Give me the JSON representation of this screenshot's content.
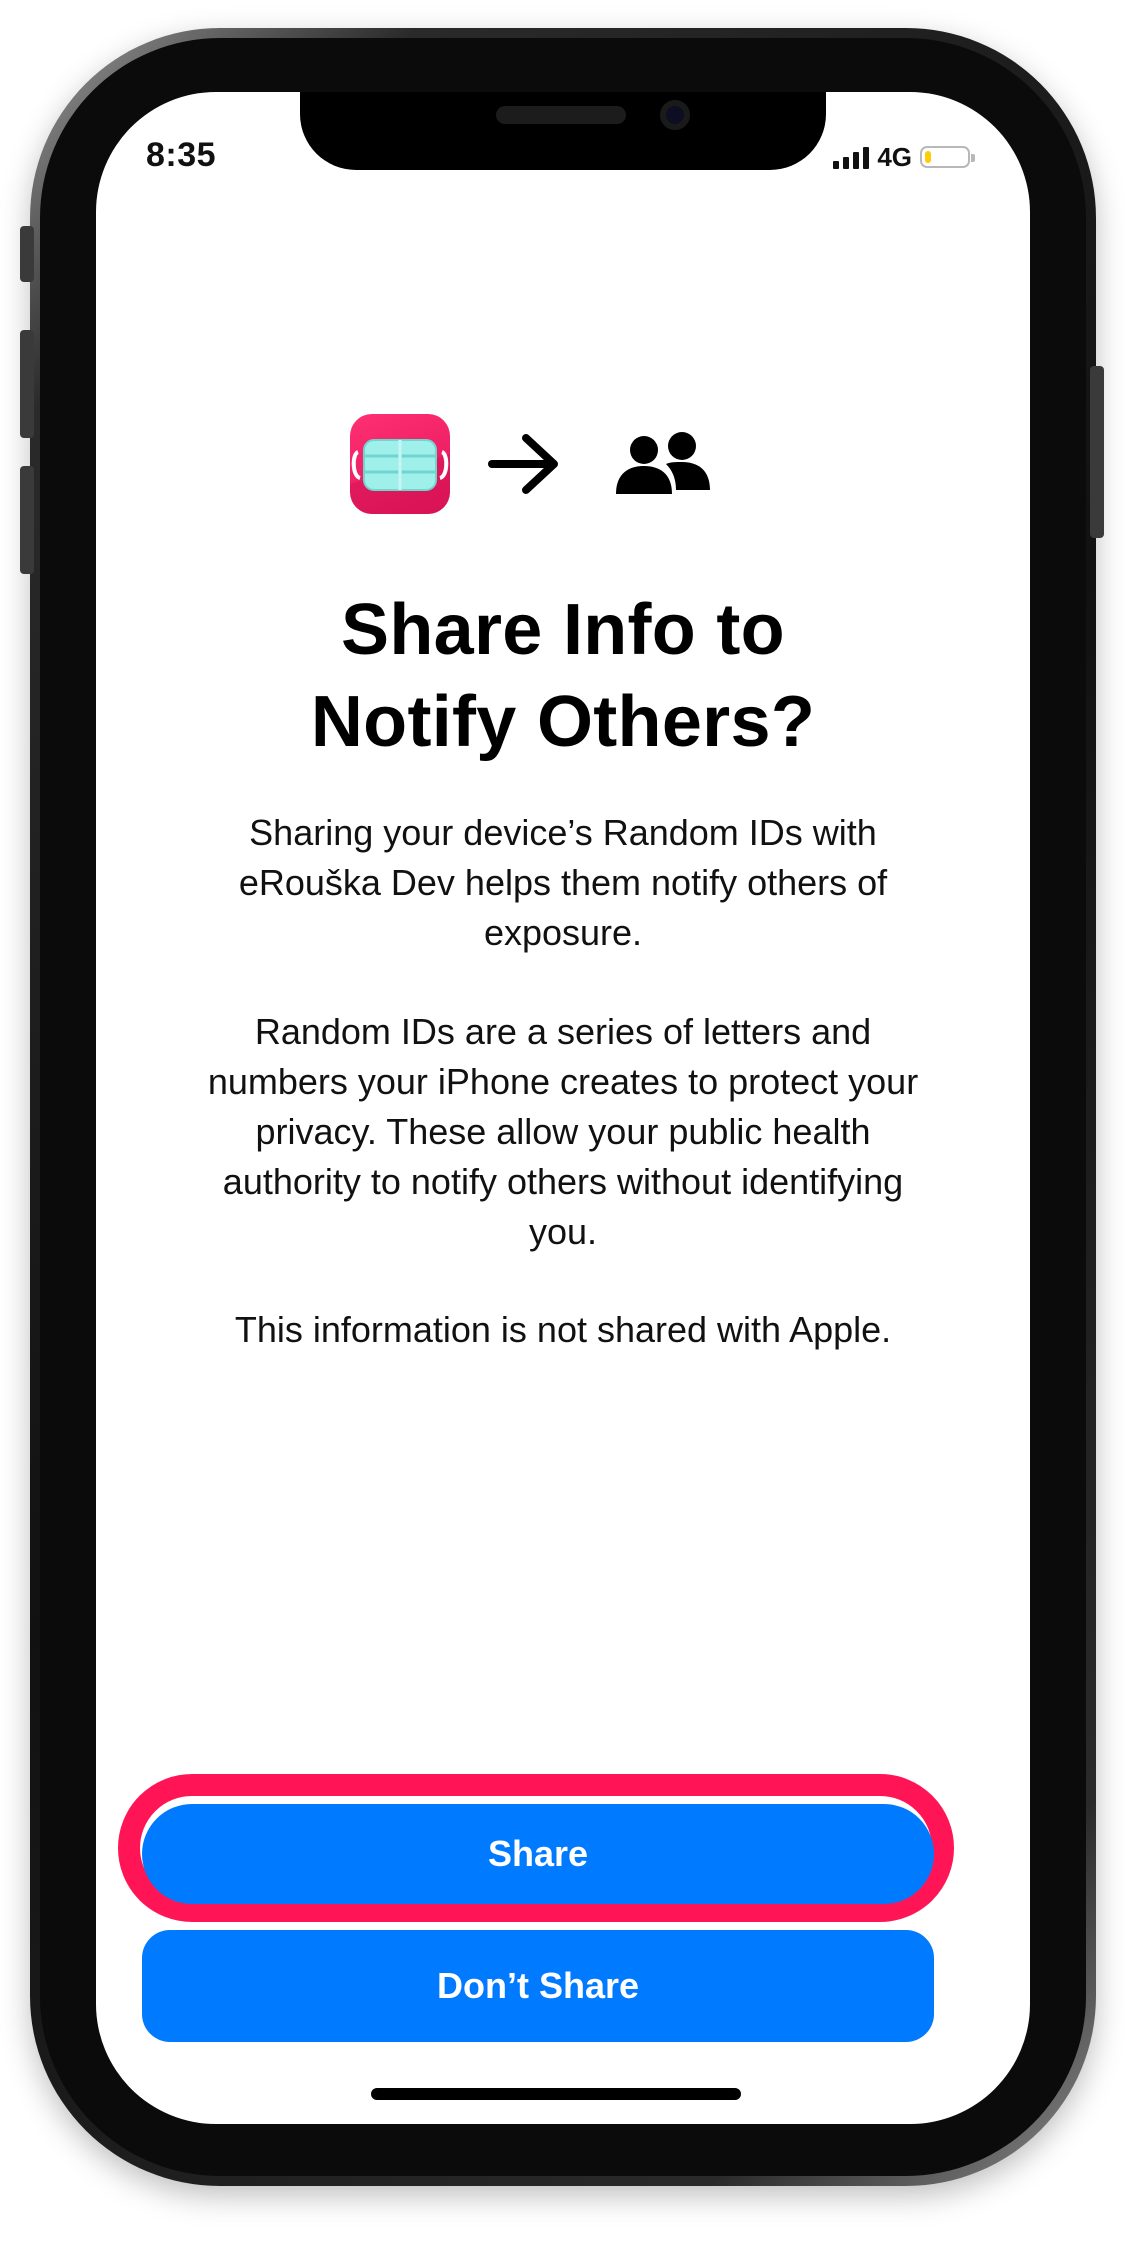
{
  "status_bar": {
    "time": "8:35",
    "network": "4G",
    "battery_level": 0.15,
    "battery_color": "#ffcc00"
  },
  "header_icons": {
    "app_icon": "face-mask-app-icon",
    "arrow": "arrow-right-icon",
    "people": "people-icon"
  },
  "dialog": {
    "title_line1": "Share Info to",
    "title_line2": "Notify Others?",
    "paragraph1": [
      "Sharing your device’s Random IDs with",
      "eRouška Dev helps them notify others of",
      "exposure."
    ],
    "paragraph2": [
      "Random IDs are a series of letters and",
      "numbers your iPhone creates to protect your",
      "privacy. These allow your public health",
      "authority to notify others without identifying",
      "you."
    ],
    "paragraph3": "This information is not shared with Apple."
  },
  "buttons": {
    "share_label": "Share",
    "dont_share_label": "Don’t Share",
    "accent_color": "#007aff",
    "highlight_color": "#ff1556"
  }
}
